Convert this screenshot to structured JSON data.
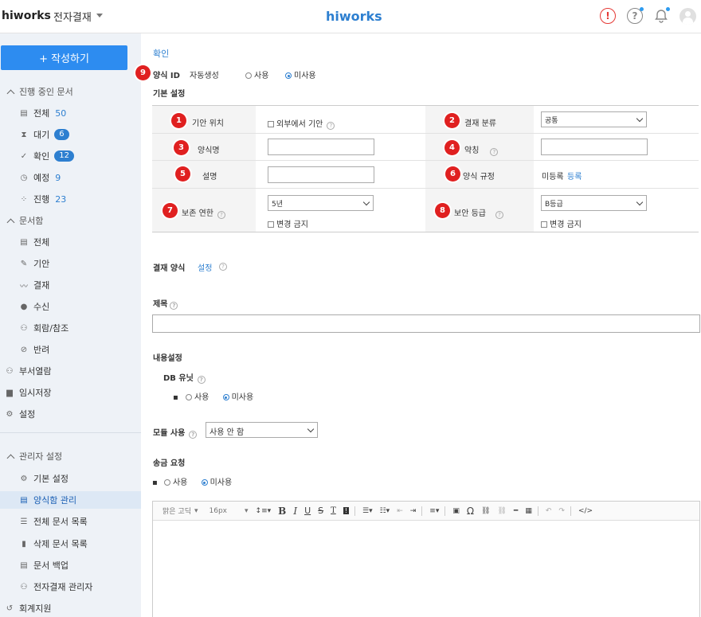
{
  "header": {
    "logo_left": "hiworks",
    "app_name": "전자결재",
    "logo_center": "hiworks"
  },
  "sidebar": {
    "compose_label": "+ 작성하기",
    "section_progress": "진행 중인 문서",
    "progress_items": [
      {
        "label": "전체",
        "count": "50"
      },
      {
        "label": "대기",
        "count": "6"
      },
      {
        "label": "확인",
        "count": "12"
      },
      {
        "label": "예정",
        "count": "9"
      },
      {
        "label": "진행",
        "count": "23"
      }
    ],
    "section_docbox": "문서함",
    "docbox_items": [
      "전체",
      "기안",
      "결재",
      "수신",
      "회람/참조",
      "반려"
    ],
    "dept_view": "부서열람",
    "temp_save": "임시저장",
    "settings": "설정",
    "section_admin": "관리자 설정",
    "admin_items": [
      "기본 설정",
      "양식함 관리",
      "전체 문서 목록",
      "삭제 문서 목록",
      "문서 백업",
      "전자결재 관리자"
    ],
    "accounting": "회계지원"
  },
  "main": {
    "confirm_link": "확인",
    "form_id_label": "양식 ID",
    "form_id_value": "자동생성",
    "use_label": "사용",
    "nonuse_label": "미사용",
    "basic_settings": "기본 설정",
    "fields": {
      "draft_position": "기안 위치",
      "external_draft": "외부에서 기안",
      "approval_category": "결재 분류",
      "approval_category_value": "공통",
      "form_name": "양식명",
      "abbreviation": "약칭",
      "description": "설명",
      "form_rule": "양식 규정",
      "form_rule_status": "미등록",
      "form_rule_register": "등록",
      "retention_period": "보존 연한",
      "retention_value": "5년",
      "no_change": "변경 금지",
      "security_level": "보안 등급",
      "security_value": "B등급"
    },
    "approval_form": "결재 양식",
    "approval_form_setting": "설정",
    "title_label": "제목",
    "content_settings": "내용설정",
    "db_unit": "DB 유닛",
    "module_use": "모듈 사용",
    "module_value": "사용 안 함",
    "remittance": "송금 요청",
    "editor": {
      "font": "맑은 고딕",
      "size": "16px"
    }
  },
  "annotations": [
    "1",
    "2",
    "3",
    "4",
    "5",
    "6",
    "7",
    "8",
    "9"
  ],
  "colors": {
    "accent": "#2d8cf0",
    "marker": "#e02020",
    "sidebar_bg": "#eef2f7"
  }
}
